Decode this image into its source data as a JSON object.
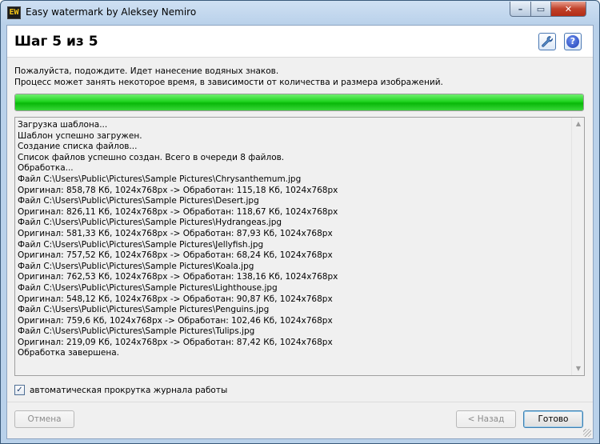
{
  "window": {
    "title": "Easy watermark by Aleksey Nemiro",
    "icon_text": "EW",
    "controls": {
      "minimize": "–",
      "maximize": "▭",
      "close": "✕"
    }
  },
  "header": {
    "step_title": "Шаг 5 из 5",
    "settings_icon": "wrench-icon",
    "help_icon": "help-icon",
    "help_glyph": "?"
  },
  "description": {
    "line1": "Пожалуйста, подождите. Идет нанесение водяных знаков.",
    "line2": "Процесс может занять некоторое время, в зависимости от количества и размера изображений."
  },
  "progress": {
    "fraction": 1.0,
    "color": "#1fd31f"
  },
  "log": {
    "lines": [
      "Загрузка шаблона...",
      "Шаблон успешно загружен.",
      "Создание списка файлов...",
      "Список файлов успешно создан. Всего в очереди 8 файлов.",
      "Обработка...",
      "Файл C:\\Users\\Public\\Pictures\\Sample Pictures\\Chrysanthemum.jpg",
      "Оригинал: 858,78 Кб, 1024x768px -> Обработан: 115,18 Кб, 1024x768px",
      "Файл C:\\Users\\Public\\Pictures\\Sample Pictures\\Desert.jpg",
      "Оригинал: 826,11 Кб, 1024x768px -> Обработан: 118,67 Кб, 1024x768px",
      "Файл C:\\Users\\Public\\Pictures\\Sample Pictures\\Hydrangeas.jpg",
      "Оригинал: 581,33 Кб, 1024x768px -> Обработан: 87,93 Кб, 1024x768px",
      "Файл C:\\Users\\Public\\Pictures\\Sample Pictures\\Jellyfish.jpg",
      "Оригинал: 757,52 Кб, 1024x768px -> Обработан: 68,24 Кб, 1024x768px",
      "Файл C:\\Users\\Public\\Pictures\\Sample Pictures\\Koala.jpg",
      "Оригинал: 762,53 Кб, 1024x768px -> Обработан: 138,16 Кб, 1024x768px",
      "Файл C:\\Users\\Public\\Pictures\\Sample Pictures\\Lighthouse.jpg",
      "Оригинал: 548,12 Кб, 1024x768px -> Обработан: 90,87 Кб, 1024x768px",
      "Файл C:\\Users\\Public\\Pictures\\Sample Pictures\\Penguins.jpg",
      "Оригинал: 759,6 Кб, 1024x768px -> Обработан: 102,46 Кб, 1024x768px",
      "Файл C:\\Users\\Public\\Pictures\\Sample Pictures\\Tulips.jpg",
      "Оригинал: 219,09 Кб, 1024x768px -> Обработан: 87,42 Кб, 1024x768px",
      "Обработка завершена."
    ],
    "scroll_up": "▲",
    "scroll_down": "▼"
  },
  "autoscroll": {
    "label": "автоматическая прокрутка журнала работы",
    "checked": true,
    "check_glyph": "✓"
  },
  "buttons": {
    "cancel": "Отмена",
    "back": "< Назад",
    "done": "Готово"
  }
}
